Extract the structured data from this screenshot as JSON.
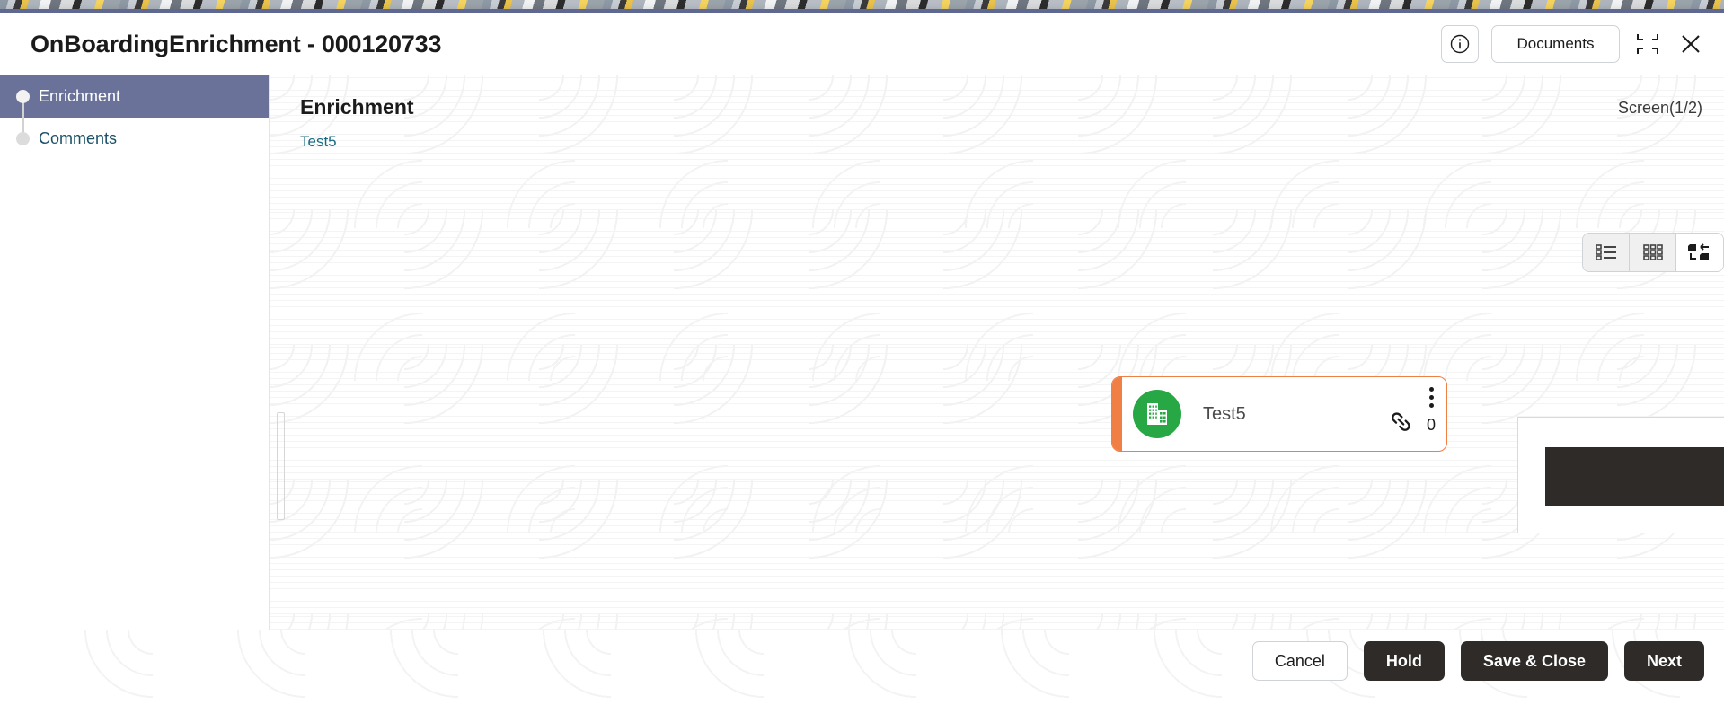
{
  "window": {
    "title": "OnBoardingEnrichment - 000120733",
    "info_icon": "info-circle-icon",
    "documents_label": "Documents",
    "minimize_icon": "minimize-restore-icon",
    "close_icon": "close-icon"
  },
  "sidebar": {
    "items": [
      {
        "label": "Enrichment",
        "active": true
      },
      {
        "label": "Comments",
        "active": false
      }
    ]
  },
  "content": {
    "page_title": "Enrichment",
    "breadcrumb": "Test5",
    "screen_counter": "Screen(1/2)",
    "view_toggles": [
      {
        "name": "list-view",
        "icon": "list-view-icon",
        "active": false
      },
      {
        "name": "grid-view",
        "icon": "grid-view-icon",
        "active": false
      },
      {
        "name": "tree-view",
        "icon": "tree-hierarchy-icon",
        "active": true
      }
    ]
  },
  "entity_card": {
    "title": "Test5",
    "avatar_icon": "building-office-icon",
    "avatar_color": "#28a745",
    "accent_color": "#ef7f45",
    "menu_icon": "kebab-menu-icon",
    "link_icon": "link-chain-icon",
    "link_count": "0"
  },
  "footer": {
    "buttons": [
      {
        "label": "Cancel",
        "style": "secondary"
      },
      {
        "label": "Hold",
        "style": "primary"
      },
      {
        "label": "Save & Close",
        "style": "primary"
      },
      {
        "label": "Next",
        "style": "primary"
      }
    ]
  },
  "colors": {
    "sidebar_active": "#6b7299",
    "accent_orange": "#ef7f45",
    "avatar_green": "#28a745",
    "link_teal": "#186a80",
    "button_dark": "#2e2b29"
  }
}
